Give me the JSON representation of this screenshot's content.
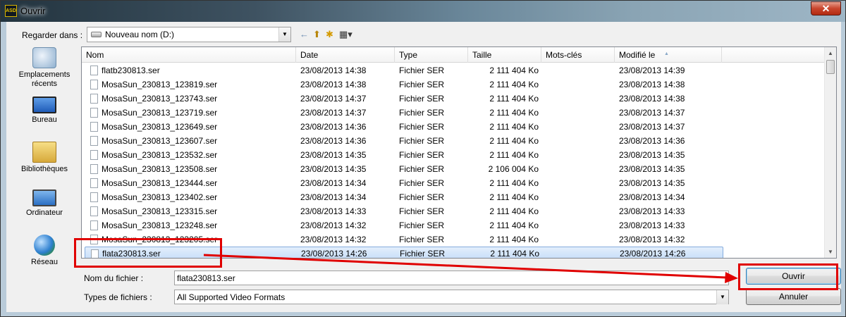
{
  "window": {
    "title": "Ouvrir",
    "app_icon_text": "ASD",
    "close_label": "✕"
  },
  "toolbar": {
    "look_in_label": "Regarder dans :",
    "look_in_value": "Nouveau nom (D:)",
    "back_icon": "←",
    "up_folder_icon": "⬆",
    "new_folder_icon": "✱",
    "view_menu_icon": "▦▾"
  },
  "places": [
    {
      "label": "Emplacements récents",
      "icon": "recent-places-icon"
    },
    {
      "label": "Bureau",
      "icon": "desktop-icon"
    },
    {
      "label": "Bibliothèques",
      "icon": "libraries-icon"
    },
    {
      "label": "Ordinateur",
      "icon": "computer-icon"
    },
    {
      "label": "Réseau",
      "icon": "network-icon"
    }
  ],
  "columns": {
    "name": "Nom",
    "date": "Date",
    "type": "Type",
    "size": "Taille",
    "tags": "Mots-clés",
    "modified": "Modifié le"
  },
  "files": [
    {
      "name": "flatb230813.ser",
      "date": "23/08/2013 14:38",
      "type": "Fichier SER",
      "size": "2 111 404 Ko",
      "modified": "23/08/2013 14:39"
    },
    {
      "name": "MosaSun_230813_123819.ser",
      "date": "23/08/2013 14:38",
      "type": "Fichier SER",
      "size": "2 111 404 Ko",
      "modified": "23/08/2013 14:38"
    },
    {
      "name": "MosaSun_230813_123743.ser",
      "date": "23/08/2013 14:37",
      "type": "Fichier SER",
      "size": "2 111 404 Ko",
      "modified": "23/08/2013 14:38"
    },
    {
      "name": "MosaSun_230813_123719.ser",
      "date": "23/08/2013 14:37",
      "type": "Fichier SER",
      "size": "2 111 404 Ko",
      "modified": "23/08/2013 14:37"
    },
    {
      "name": "MosaSun_230813_123649.ser",
      "date": "23/08/2013 14:36",
      "type": "Fichier SER",
      "size": "2 111 404 Ko",
      "modified": "23/08/2013 14:37"
    },
    {
      "name": "MosaSun_230813_123607.ser",
      "date": "23/08/2013 14:36",
      "type": "Fichier SER",
      "size": "2 111 404 Ko",
      "modified": "23/08/2013 14:36"
    },
    {
      "name": "MosaSun_230813_123532.ser",
      "date": "23/08/2013 14:35",
      "type": "Fichier SER",
      "size": "2 111 404 Ko",
      "modified": "23/08/2013 14:35"
    },
    {
      "name": "MosaSun_230813_123508.ser",
      "date": "23/08/2013 14:35",
      "type": "Fichier SER",
      "size": "2 106 004 Ko",
      "modified": "23/08/2013 14:35"
    },
    {
      "name": "MosaSun_230813_123444.ser",
      "date": "23/08/2013 14:34",
      "type": "Fichier SER",
      "size": "2 111 404 Ko",
      "modified": "23/08/2013 14:35"
    },
    {
      "name": "MosaSun_230813_123402.ser",
      "date": "23/08/2013 14:34",
      "type": "Fichier SER",
      "size": "2 111 404 Ko",
      "modified": "23/08/2013 14:34"
    },
    {
      "name": "MosaSun_230813_123315.ser",
      "date": "23/08/2013 14:33",
      "type": "Fichier SER",
      "size": "2 111 404 Ko",
      "modified": "23/08/2013 14:33"
    },
    {
      "name": "MosaSun_230813_123248.ser",
      "date": "23/08/2013 14:32",
      "type": "Fichier SER",
      "size": "2 111 404 Ko",
      "modified": "23/08/2013 14:33"
    },
    {
      "name": "MosaSun_230813_123205.ser",
      "date": "23/08/2013 14:32",
      "type": "Fichier SER",
      "size": "2 111 404 Ko",
      "modified": "23/08/2013 14:32"
    },
    {
      "name": "flata230813.ser",
      "date": "23/08/2013 14:26",
      "type": "Fichier SER",
      "size": "2 111 404 Ko",
      "modified": "23/08/2013 14:26",
      "selected": true
    }
  ],
  "form": {
    "filename_label": "Nom du fichier :",
    "filename_value": "flata230813.ser",
    "filetype_label": "Types de fichiers :",
    "filetype_value": "All Supported Video Formats"
  },
  "buttons": {
    "open": "Ouvrir",
    "cancel": "Annuler"
  },
  "scroll_arrows": {
    "up": "▲",
    "down": "▼"
  },
  "annotation_color": "#e00000"
}
